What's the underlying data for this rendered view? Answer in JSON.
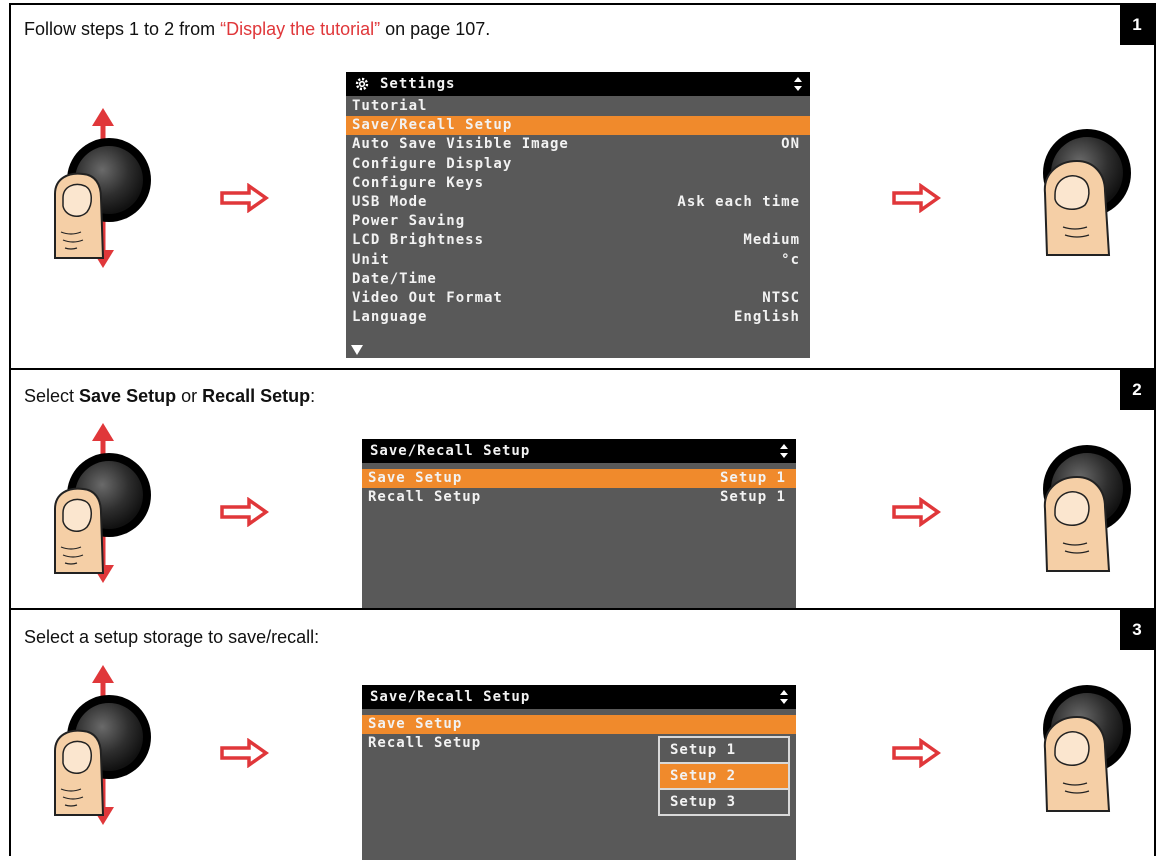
{
  "steps": [
    {
      "number": "1",
      "text_before": "Follow steps 1 to 2 from ",
      "text_link": "“Display the tutorial”",
      "text_after": " on page 107.",
      "screen": {
        "title": "Settings",
        "items": [
          {
            "label": "Tutorial",
            "value": ""
          },
          {
            "label": "Save/Recall Setup",
            "value": "",
            "selected": true
          },
          {
            "label": "Auto Save Visible Image",
            "value": "ON"
          },
          {
            "label": "Configure Display",
            "value": ""
          },
          {
            "label": "Configure Keys",
            "value": ""
          },
          {
            "label": "USB Mode",
            "value": "Ask each time"
          },
          {
            "label": "Power Saving",
            "value": ""
          },
          {
            "label": "LCD Brightness",
            "value": "Medium"
          },
          {
            "label": "Unit",
            "value": "°c"
          },
          {
            "label": "Date/Time",
            "value": ""
          },
          {
            "label": "Video Out Format",
            "value": "NTSC"
          },
          {
            "label": "Language",
            "value": "English"
          }
        ]
      }
    },
    {
      "number": "2",
      "text_pre": "Select ",
      "bold1": "Save Setup",
      "text_mid": " or ",
      "bold2": "Recall Setup",
      "text_post": ":",
      "screen": {
        "title": "Save/Recall Setup",
        "items": [
          {
            "label": "Save Setup",
            "value": "Setup 1",
            "selected": true
          },
          {
            "label": "Recall Setup",
            "value": "Setup 1"
          }
        ]
      }
    },
    {
      "number": "3",
      "text": "Select a setup storage to save/recall:",
      "screen": {
        "title": "Save/Recall Setup",
        "items": [
          {
            "label": "Save Setup",
            "value": "",
            "selected": true
          },
          {
            "label": "Recall Setup",
            "value": ""
          }
        ],
        "popup": [
          "Setup 1",
          "Setup 2",
          "Setup 3"
        ],
        "popup_selected": "Setup 2"
      }
    }
  ],
  "colors": {
    "highlight": "#f08a2c",
    "arrow": "#e0373a",
    "screen_bg": "#595959"
  },
  "icons": {
    "turn_knob": "knob-turn-icon",
    "press_knob": "knob-press-icon",
    "next": "right-arrow-icon",
    "gear": "gear-icon"
  }
}
